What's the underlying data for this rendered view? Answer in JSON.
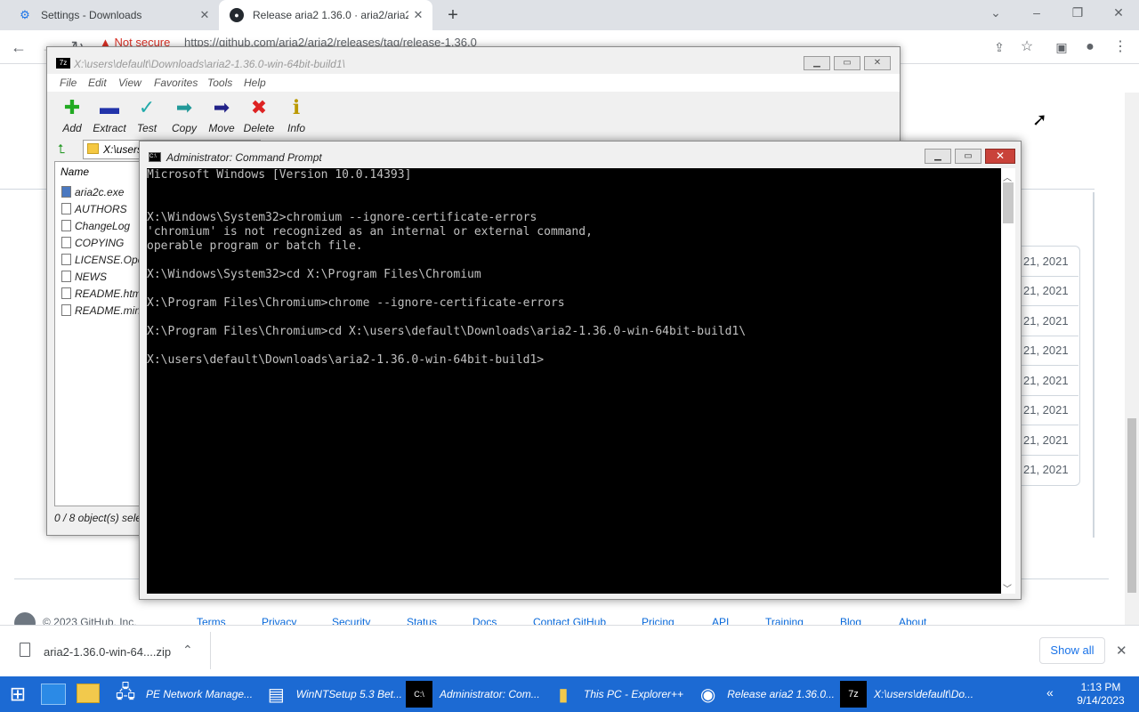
{
  "browser": {
    "tabs": [
      {
        "label": "Settings - Downloads",
        "icon": "gear-icon"
      },
      {
        "label": "Release aria2 1.36.0 · aria2/aria2",
        "icon": "github-icon"
      }
    ],
    "omnibox": {
      "security": "Not secure",
      "url": "https://github.com/aria2/aria2/releases/tag/release-1.36.0"
    }
  },
  "github": {
    "dates": [
      "21, 2021",
      "21, 2021",
      "21, 2021",
      "21, 2021",
      "21, 2021",
      "21, 2021",
      "21, 2021",
      "21, 2021"
    ],
    "footer": {
      "copyright": "© 2023 GitHub, Inc.",
      "links": [
        "Terms",
        "Privacy",
        "Security",
        "Status",
        "Docs",
        "Contact GitHub",
        "Pricing",
        "API",
        "Training",
        "Blog",
        "About"
      ]
    }
  },
  "downloads": {
    "file": "aria2-1.36.0-win-64....zip",
    "show_all": "Show all"
  },
  "zip": {
    "title": "X:\\users\\default\\Downloads\\aria2-1.36.0-win-64bit-build1\\",
    "menu": [
      "File",
      "Edit",
      "View",
      "Favorites",
      "Tools",
      "Help"
    ],
    "tools": [
      "Add",
      "Extract",
      "Test",
      "Copy",
      "Move",
      "Delete",
      "Info"
    ],
    "address": "X:\\users",
    "column": "Name",
    "files": [
      "aria2c.exe",
      "AUTHORS",
      "ChangeLog",
      "COPYING",
      "LICENSE.OpenSSL",
      "NEWS",
      "README.html",
      "README.mingw"
    ],
    "status": "0 / 8 object(s) selected"
  },
  "cmd": {
    "title": "Administrator: Command Prompt",
    "lines": [
      "Microsoft Windows [Version 10.0.14393]",
      "",
      "",
      "X:\\Windows\\System32>chromium --ignore-certificate-errors",
      "'chromium' is not recognized as an internal or external command,",
      "operable program or batch file.",
      "",
      "X:\\Windows\\System32>cd X:\\Program Files\\Chromium",
      "",
      "X:\\Program Files\\Chromium>chrome --ignore-certificate-errors",
      "",
      "X:\\Program Files\\Chromium>cd X:\\users\\default\\Downloads\\aria2-1.36.0-win-64bit-build1\\",
      "",
      "X:\\users\\default\\Downloads\\aria2-1.36.0-win-64bit-build1>"
    ]
  },
  "taskbar": {
    "items": [
      {
        "label": "PE Network Manage...",
        "icon": "network-manager-icon"
      },
      {
        "label": "WinNTSetup 5.3 Bet...",
        "icon": "winntsetup-icon"
      },
      {
        "label": "Administrator: Com...",
        "icon": "cmd-icon"
      },
      {
        "label": "This PC - Explorer++",
        "icon": "explorer-icon"
      },
      {
        "label": "Release aria2 1.36.0...",
        "icon": "chromium-icon"
      },
      {
        "label": "X:\\users\\default\\Do...",
        "icon": "7zip-icon"
      }
    ],
    "time": "1:13 PM",
    "date": "9/14/2023"
  },
  "colors": {
    "taskbar": "#1c6ad3",
    "console_bg": "#000000",
    "console_fg": "#c0c0c0",
    "close_red": "#c9423a"
  }
}
